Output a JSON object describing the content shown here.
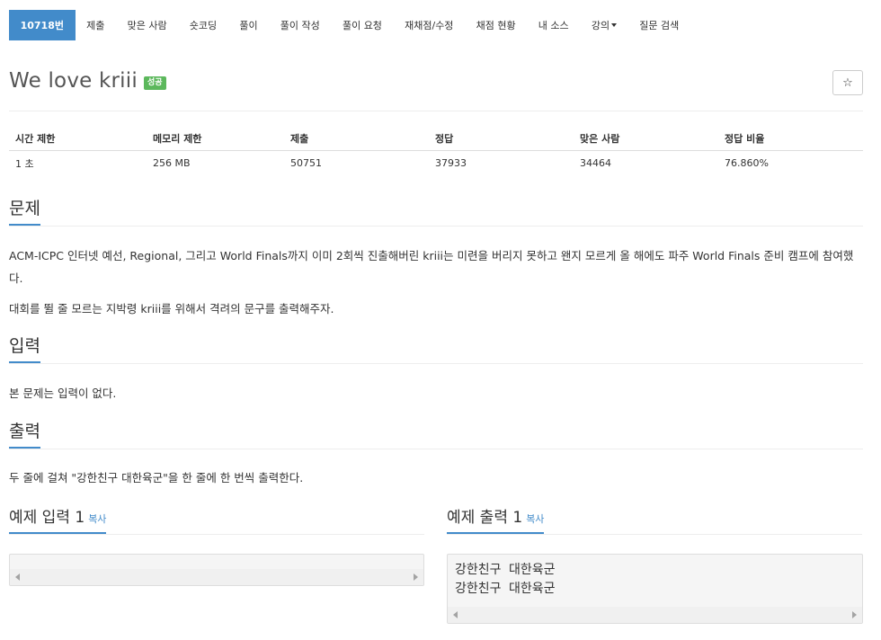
{
  "nav": {
    "items": [
      {
        "label": "10718번",
        "active": true
      },
      {
        "label": "제출"
      },
      {
        "label": "맞은 사람"
      },
      {
        "label": "숏코딩"
      },
      {
        "label": "풀이"
      },
      {
        "label": "풀이 작성"
      },
      {
        "label": "풀이 요청"
      },
      {
        "label": "재채점/수정"
      },
      {
        "label": "채점 현황"
      },
      {
        "label": "내 소스"
      },
      {
        "label": "강의"
      },
      {
        "label": "질문 검색"
      }
    ]
  },
  "problem": {
    "title": "We love kriii",
    "status_badge": "성공",
    "star_icon": "star-outline-icon",
    "star_glyph": "☆"
  },
  "info_table": {
    "headers": [
      "시간 제한",
      "메모리 제한",
      "제출",
      "정답",
      "맞은 사람",
      "정답 비율"
    ],
    "row": [
      "1 초",
      "256 MB",
      "50751",
      "37933",
      "34464",
      "76.860%"
    ]
  },
  "sections": {
    "description": {
      "title": "문제",
      "paragraphs": [
        "ACM-ICPC 인터넷 예선, Regional, 그리고 World Finals까지 이미 2회씩 진출해버린 kriii는 미련을 버리지 못하고 왠지 모르게 올 해에도 파주 World Finals 준비 캠프에 참여했다.",
        "대회를 뛸 줄 모르는 지박령 kriii를 위해서 격려의 문구를 출력해주자."
      ]
    },
    "input": {
      "title": "입력",
      "text": "본 문제는 입력이 없다."
    },
    "output": {
      "title": "출력",
      "text": "두 줄에 걸쳐 \"강한친구 대한육군\"을 한 줄에 한 번씩 출력한다."
    }
  },
  "samples": {
    "input": {
      "title": "예제 입력 1",
      "copy_label": "복사",
      "content": ""
    },
    "output": {
      "title": "예제 출력 1",
      "copy_label": "복사",
      "content": "강한친구 대한육군\n강한친구 대한육군"
    }
  },
  "colors": {
    "accent": "#428bca",
    "success": "#5cb85c"
  }
}
